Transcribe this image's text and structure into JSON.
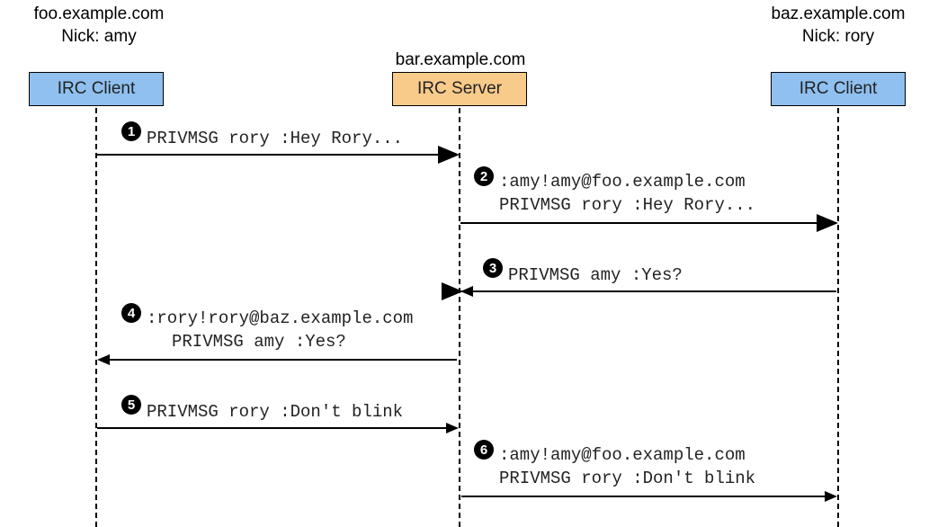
{
  "participants": {
    "left": {
      "host": "foo.example.com",
      "nick_line": "Nick: amy",
      "box": "IRC Client"
    },
    "middle": {
      "host": "bar.example.com",
      "box": "IRC Server"
    },
    "right": {
      "host": "baz.example.com",
      "nick_line": "Nick: rory",
      "box": "IRC Client"
    }
  },
  "steps": {
    "s1": {
      "num": "1",
      "line1": "PRIVMSG rory :Hey Rory..."
    },
    "s2": {
      "num": "2",
      "line1": ":amy!amy@foo.example.com",
      "line2": "PRIVMSG rory :Hey Rory..."
    },
    "s3": {
      "num": "3",
      "line1": "PRIVMSG amy :Yes?"
    },
    "s4": {
      "num": "4",
      "line1": ":rory!rory@baz.example.com",
      "line2": "PRIVMSG amy :Yes?"
    },
    "s5": {
      "num": "5",
      "line1": "PRIVMSG rory :Don't blink"
    },
    "s6": {
      "num": "6",
      "line1": ":amy!amy@foo.example.com",
      "line2": "PRIVMSG rory :Don't blink"
    }
  },
  "chart_data": {
    "type": "sequence-diagram",
    "participants": [
      {
        "id": "clientA",
        "label": "IRC Client",
        "host": "foo.example.com",
        "nick": "amy"
      },
      {
        "id": "server",
        "label": "IRC Server",
        "host": "bar.example.com"
      },
      {
        "id": "clientB",
        "label": "IRC Client",
        "host": "baz.example.com",
        "nick": "rory"
      }
    ],
    "messages": [
      {
        "step": 1,
        "from": "clientA",
        "to": "server",
        "text": "PRIVMSG rory :Hey Rory..."
      },
      {
        "step": 2,
        "from": "server",
        "to": "clientB",
        "text": ":amy!amy@foo.example.com PRIVMSG rory :Hey Rory..."
      },
      {
        "step": 3,
        "from": "clientB",
        "to": "server",
        "text": "PRIVMSG amy :Yes?"
      },
      {
        "step": 4,
        "from": "server",
        "to": "clientA",
        "text": ":rory!rory@baz.example.com PRIVMSG amy :Yes?"
      },
      {
        "step": 5,
        "from": "clientA",
        "to": "server",
        "text": "PRIVMSG rory :Don't blink"
      },
      {
        "step": 6,
        "from": "server",
        "to": "clientB",
        "text": ":amy!amy@foo.example.com PRIVMSG rory :Don't blink"
      }
    ]
  }
}
